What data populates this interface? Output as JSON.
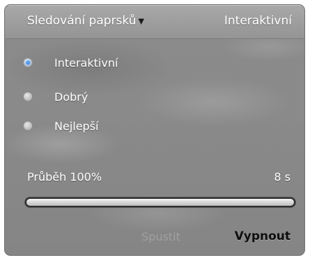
{
  "header": {
    "dropdown_label": "Sledování paprsků",
    "current_mode": "Interaktivní"
  },
  "quality_options": [
    {
      "label": "Interaktivní",
      "selected": true
    },
    {
      "label": "Dobrý",
      "selected": false
    },
    {
      "label": "Nejlepší",
      "selected": false
    }
  ],
  "progress": {
    "label": "Průběh 100%",
    "value_percent": 100,
    "time": "8 s"
  },
  "buttons": {
    "start_label": "Spustit",
    "start_enabled": false,
    "stop_label": "Vypnout"
  },
  "icons": {
    "dropdown_caret": "chevron-down-icon"
  },
  "colors": {
    "radio_selected_dot": "#1f6fd1",
    "text": "#ffffff",
    "stop_button_text": "#0e0e0e"
  }
}
